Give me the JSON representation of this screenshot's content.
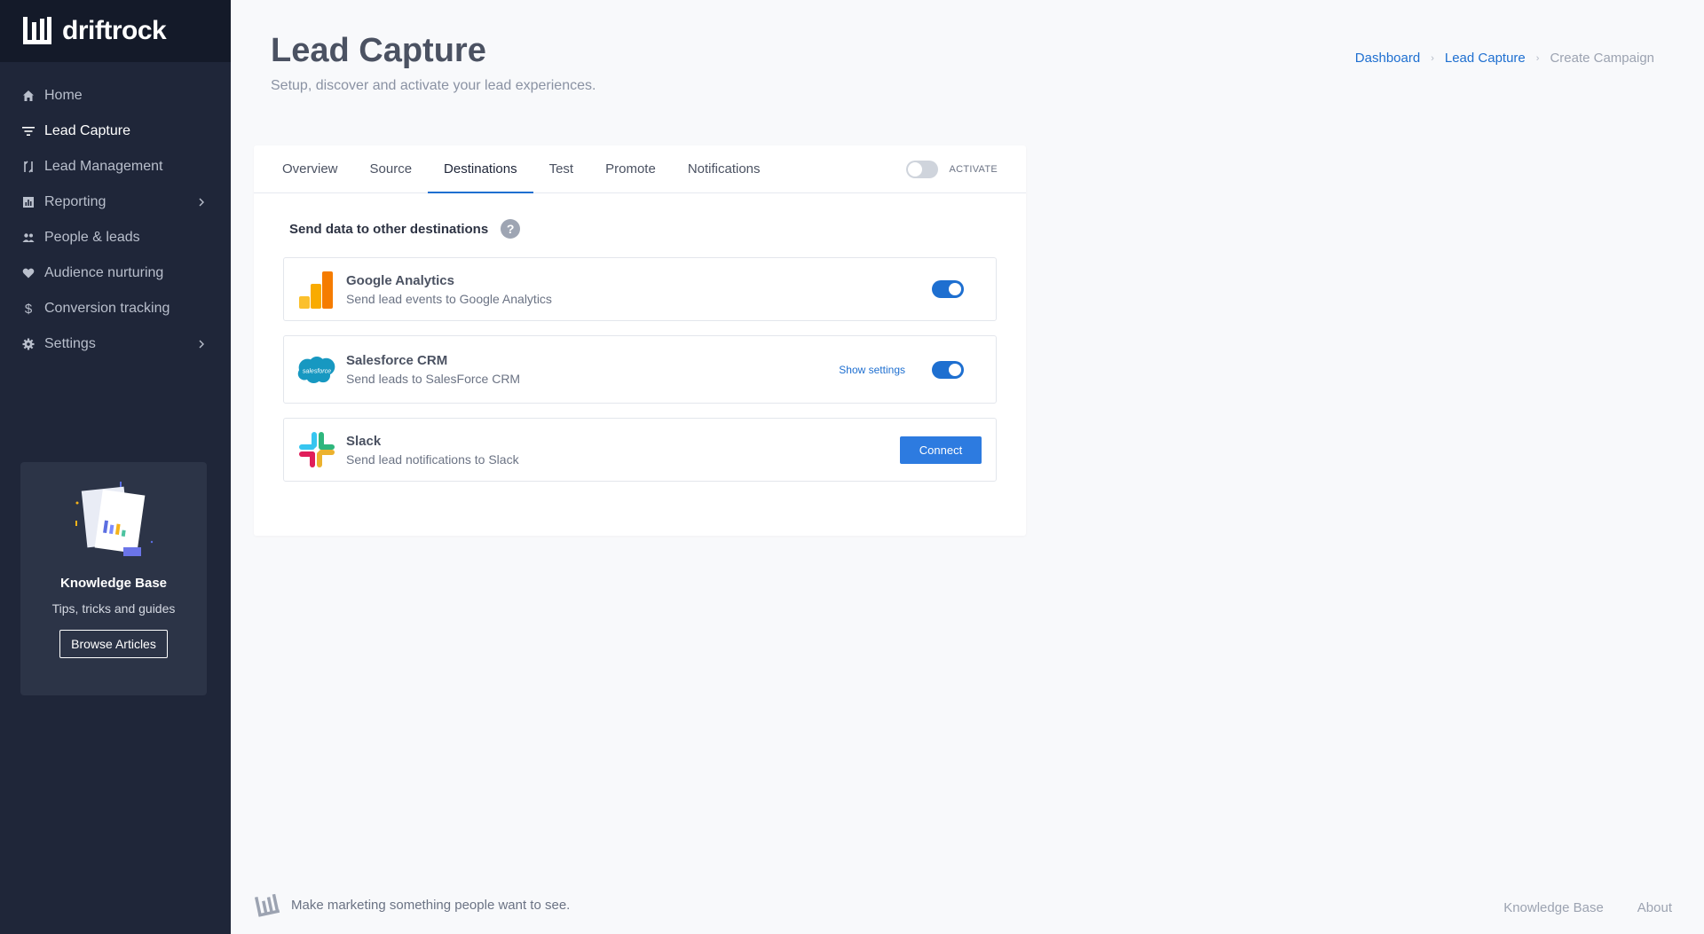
{
  "app": {
    "brand": "driftrock"
  },
  "sidebar": {
    "items": [
      {
        "label": "Home",
        "icon": "home-icon"
      },
      {
        "label": "Lead Capture",
        "icon": "filter-icon",
        "active": true
      },
      {
        "label": "Lead Management",
        "icon": "management-icon"
      },
      {
        "label": "Reporting",
        "icon": "chart-icon",
        "has_submenu": true
      },
      {
        "label": "People & leads",
        "icon": "people-icon"
      },
      {
        "label": "Audience nurturing",
        "icon": "heart-icon"
      },
      {
        "label": "Conversion tracking",
        "icon": "dollar-icon"
      },
      {
        "label": "Settings",
        "icon": "gear-icon",
        "has_submenu": true
      }
    ],
    "knowledge_card": {
      "title": "Knowledge Base",
      "subtitle": "Tips, tricks and guides",
      "button": "Browse Articles"
    }
  },
  "header": {
    "title": "Lead Capture",
    "subtitle": "Setup, discover and activate your lead experiences.",
    "breadcrumb": {
      "dashboard": "Dashboard",
      "lead_capture": "Lead Capture",
      "current": "Create Campaign"
    }
  },
  "panel": {
    "tabs": [
      {
        "label": "Overview"
      },
      {
        "label": "Source"
      },
      {
        "label": "Destinations",
        "active": true
      },
      {
        "label": "Test"
      },
      {
        "label": "Promote"
      },
      {
        "label": "Notifications"
      }
    ],
    "activate_label": "ACTIVATE",
    "activate_on": false,
    "section_title": "Send data to other destinations",
    "help_glyph": "?",
    "destinations": [
      {
        "name": "Google Analytics",
        "description": "Send lead events to Google Analytics",
        "enabled": true,
        "icon": "google-analytics-icon"
      },
      {
        "name": "Salesforce CRM",
        "description": "Send leads to SalesForce CRM",
        "enabled": true,
        "settings_link": "Show settings",
        "icon": "salesforce-icon",
        "icon_text": "salesforce"
      },
      {
        "name": "Slack",
        "description": "Send lead notifications to Slack",
        "connect_label": "Connect",
        "icon": "slack-icon"
      }
    ]
  },
  "footer": {
    "tagline": "Make marketing something people want to see.",
    "links": {
      "knowledge_base": "Knowledge Base",
      "about": "About"
    }
  },
  "colors": {
    "sidebar_bg": "#1f2639",
    "logo_bar_bg": "#141a29",
    "accent": "#1e6fd0",
    "page_bg": "#f8f9fb"
  }
}
